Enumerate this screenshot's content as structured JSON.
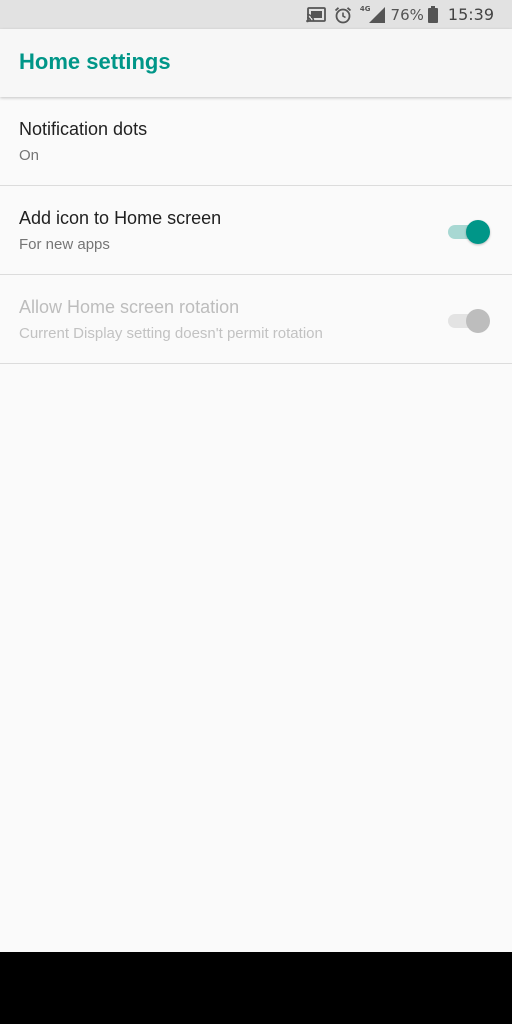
{
  "status_bar": {
    "icons": [
      "cast-icon",
      "alarm-icon",
      "signal-4g-icon",
      "battery-icon"
    ],
    "network_label": "4G",
    "battery_percent": "76%",
    "time": "15:39"
  },
  "app_bar": {
    "title": "Home settings"
  },
  "settings": [
    {
      "title": "Notification dots",
      "summary": "On",
      "has_switch": false,
      "enabled": true
    },
    {
      "title": "Add icon to Home screen",
      "summary": "For new apps",
      "has_switch": true,
      "switch_on": true,
      "enabled": true
    },
    {
      "title": "Allow Home screen rotation",
      "summary": "Current Display setting doesn't permit rotation",
      "has_switch": true,
      "switch_on": true,
      "enabled": false
    }
  ],
  "colors": {
    "accent": "#009688",
    "accent_track": "#a8d8d3",
    "status_bar_bg": "#e2e2e2",
    "background": "#fafafa",
    "nav_bar": "#000000"
  }
}
